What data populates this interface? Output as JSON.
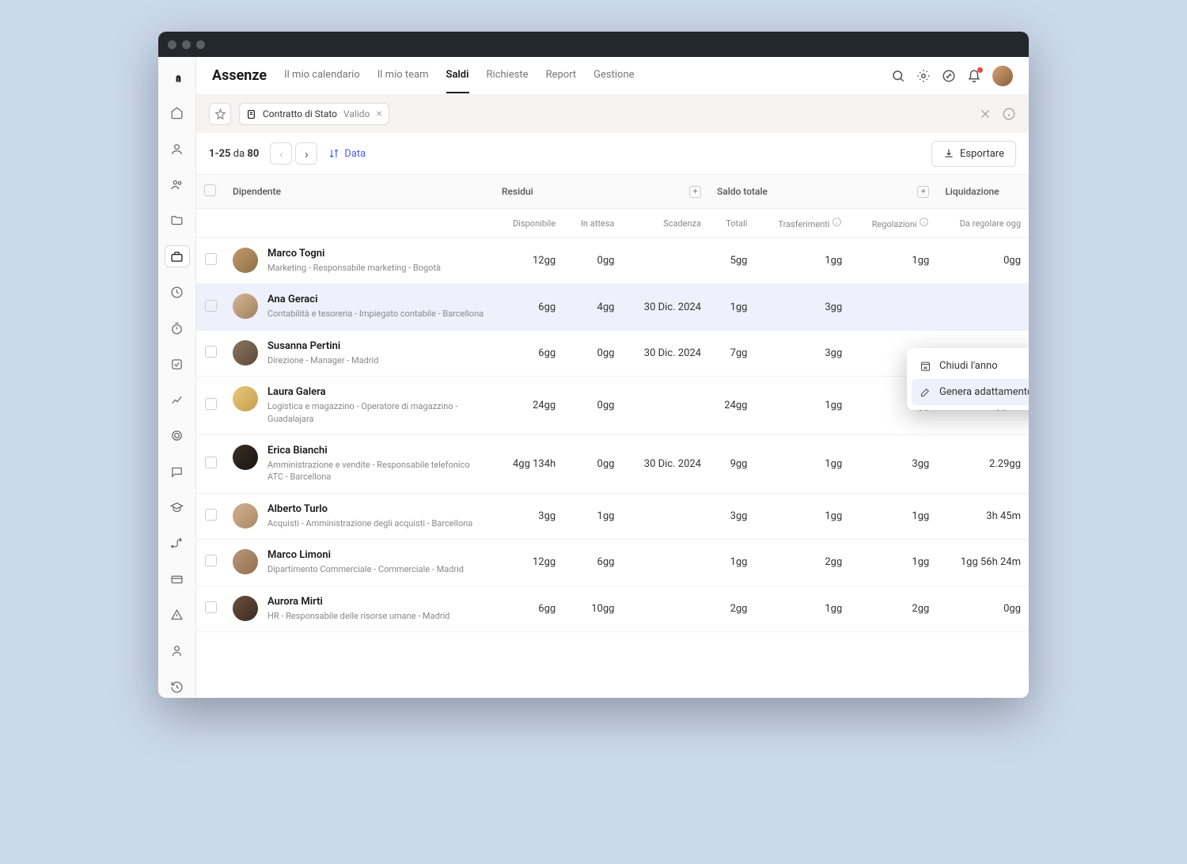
{
  "header": {
    "title": "Assenze",
    "tabs": [
      "Il mio calendario",
      "Il mio team",
      "Saldi",
      "Richieste",
      "Report",
      "Gestione"
    ],
    "active_tab": 2
  },
  "filter": {
    "chip_label": "Contratto di Stato",
    "chip_value": "Valido"
  },
  "toolbar": {
    "range": "1-25",
    "of_label": "da",
    "total": "80",
    "sort_label": "Data",
    "export_label": "Esportare"
  },
  "columns": {
    "group_employee": "Dipendente",
    "group_residui": "Residui",
    "group_saldo": "Saldo totale",
    "group_liquid": "Liquidazione",
    "disponibile": "Disponibile",
    "attesa": "In attesa",
    "scadenza": "Scadenza",
    "totali": "Totali",
    "trasferimenti": "Trasferimenti",
    "regolazioni": "Regolazioni",
    "da_regolare": "Da regolare ogg"
  },
  "rows": [
    {
      "name": "Marco Togni",
      "sub": "Marketing - Responsabile marketing - Bogotà",
      "disp": "12gg",
      "att": "0gg",
      "scad": "",
      "tot": "5gg",
      "trasf": "1gg",
      "reg": "1gg",
      "dar": "0gg",
      "av": "linear-gradient(135deg,#c49a6c,#8b6f47)"
    },
    {
      "name": "Ana Geraci",
      "sub": "Contabilità e tesoreria - Impiegato contabile - Barcellona",
      "disp": "6gg",
      "att": "4gg",
      "scad": "30 Dic. 2024",
      "tot": "1gg",
      "trasf": "3gg",
      "reg": "",
      "dar": "",
      "av": "linear-gradient(135deg,#d4b896,#a08060)",
      "hl": true
    },
    {
      "name": "Susanna Pertini",
      "sub": "Direzione - Manager - Madrid",
      "disp": "6gg",
      "att": "0gg",
      "scad": "30 Dic. 2024",
      "tot": "7gg",
      "trasf": "3gg",
      "reg": "",
      "dar": "",
      "av": "linear-gradient(135deg,#8a7560,#5c4a3a)"
    },
    {
      "name": "Laura Galera",
      "sub": "Logistica e magazzino - Operatore di magazzino - Guadalajara",
      "disp": "24gg",
      "att": "0gg",
      "scad": "",
      "tot": "24gg",
      "trasf": "1gg",
      "reg": "2gg",
      "dar": "2gg 30",
      "av": "linear-gradient(135deg,#e8c878,#c4a050)"
    },
    {
      "name": "Erica Bianchi",
      "sub": "Amministrazione e vendite - Responsabile telefonico ATC - Barcellona",
      "disp": "4gg 134h",
      "att": "0gg",
      "scad": "30 Dic. 2024",
      "tot": "9gg",
      "trasf": "1gg",
      "reg": "3gg",
      "dar": "2.29gg",
      "av": "linear-gradient(135deg,#3a3028,#1a1410)"
    },
    {
      "name": "Alberto Turlo",
      "sub": "Acquisti - Amministrazione degli acquisti - Barcellona",
      "disp": "3gg",
      "att": "1gg",
      "scad": "",
      "tot": "3gg",
      "trasf": "1gg",
      "reg": "1gg",
      "dar": "3h 45m",
      "av": "linear-gradient(135deg,#d4b090,#a88868)"
    },
    {
      "name": "Marco Limoni",
      "sub": "Dipartimento Commerciale - Commerciale - Madrid",
      "disp": "12gg",
      "att": "6gg",
      "scad": "",
      "tot": "1gg",
      "trasf": "2gg",
      "reg": "1gg",
      "dar": "1gg 56h 24m",
      "av": "linear-gradient(135deg,#b89878,#907050)"
    },
    {
      "name": "Aurora Mirti",
      "sub": "HR - Responsabile delle risorse umane - Madrid",
      "disp": "6gg",
      "att": "10gg",
      "scad": "",
      "tot": "2gg",
      "trasf": "1gg",
      "reg": "2gg",
      "dar": "0gg",
      "av": "linear-gradient(135deg,#6a5040,#3c2a1e)"
    }
  ],
  "context_menu": {
    "item1": "Chiudi l'anno",
    "item2": "Genera adattamento"
  }
}
